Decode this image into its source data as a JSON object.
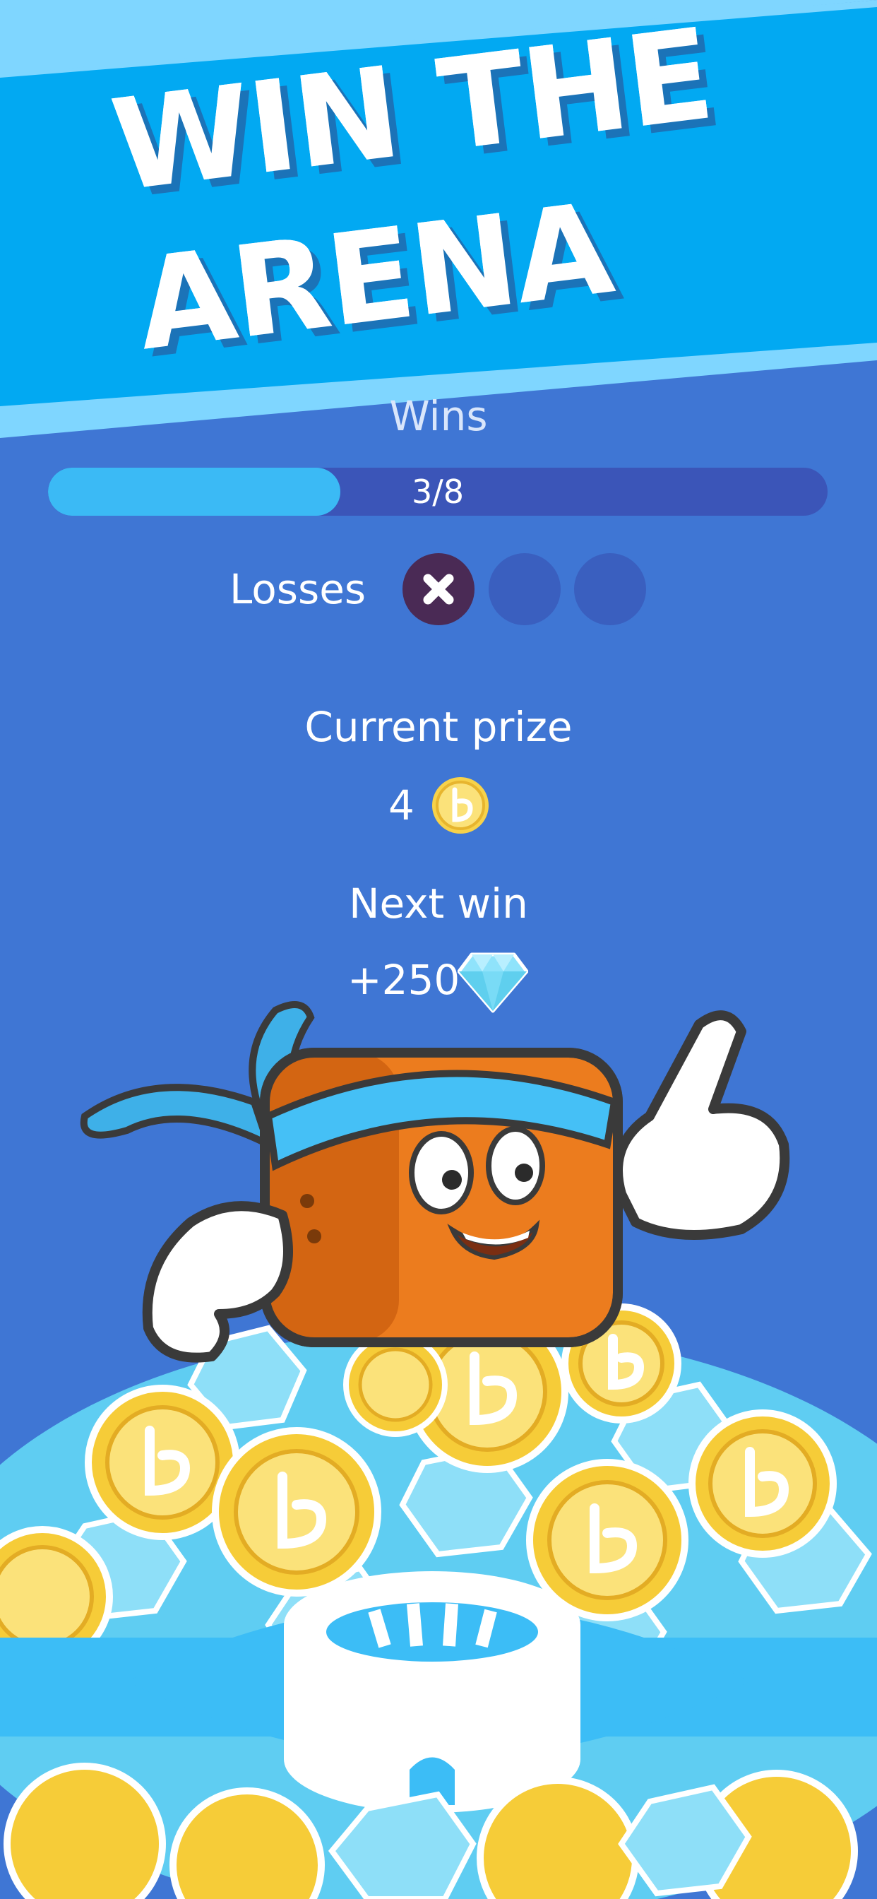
{
  "banner": {
    "title_line_1": "WIN THE",
    "title_line_2": "ARENA"
  },
  "wins": {
    "label": "Wins",
    "count_text": "3/8",
    "progress": 0.375
  },
  "losses": {
    "label": "Losses",
    "used": 1,
    "total": 3
  },
  "prize": {
    "label": "Current prize",
    "value": "4",
    "icon": "coin-icon"
  },
  "next_win": {
    "label": "Next win",
    "value": "+250",
    "icon": "diamond-icon"
  },
  "colors": {
    "background": "#3f76d4",
    "banner": "#00aaf2",
    "progress_fill": "#3bbaf5",
    "progress_track": "#3b55b8",
    "loss_used": "#4a2a55"
  },
  "footer": {
    "icon": "stadium-icon"
  }
}
